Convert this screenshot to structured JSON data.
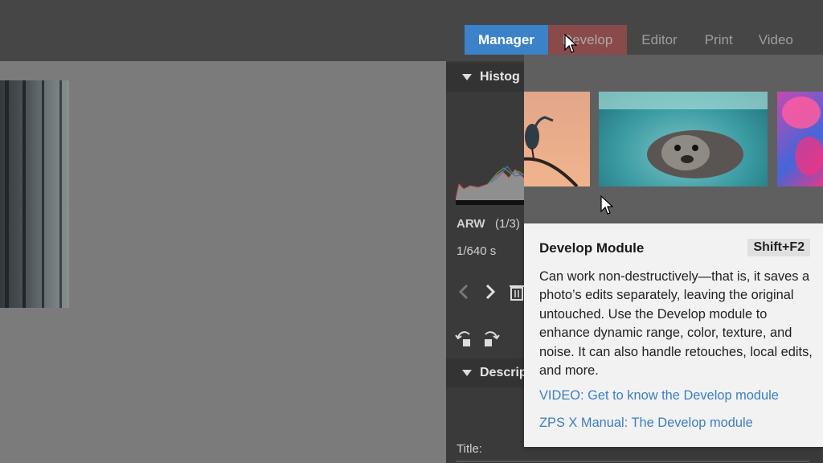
{
  "nav": {
    "tabs": [
      {
        "label": "Manager",
        "active": true
      },
      {
        "label": "Develop",
        "hovered": true
      },
      {
        "label": "Editor"
      },
      {
        "label": "Print"
      },
      {
        "label": "Video"
      }
    ]
  },
  "sidebar": {
    "histogram_header": "Histog",
    "file_type": "ARW",
    "file_index": "(1/3)",
    "shutter": "1/640 s",
    "description_header": "Descrip",
    "title_label": "Title:"
  },
  "tooltip": {
    "title": "Develop Module",
    "shortcut": "Shift+F2",
    "body": "Can work non-destructively—that is, it saves a photo’s edits separately, leaving the original untouched. Use the Develop module to enhance dynamic range, color, texture, and noise. It can also handle retouches, local edits, and more.",
    "link_video": "VIDEO: Get to know the Develop module",
    "link_manual": "ZPS X Manual: The Develop module"
  },
  "icons": [
    "prev-arrow-icon",
    "next-arrow-icon",
    "trash-icon",
    "rotate-left-icon",
    "rotate-right-icon",
    "cursor-icon"
  ],
  "colors": {
    "accent": "#3b82c8",
    "develop_hover": "#8a4a4a",
    "link": "#3b7fc4"
  }
}
